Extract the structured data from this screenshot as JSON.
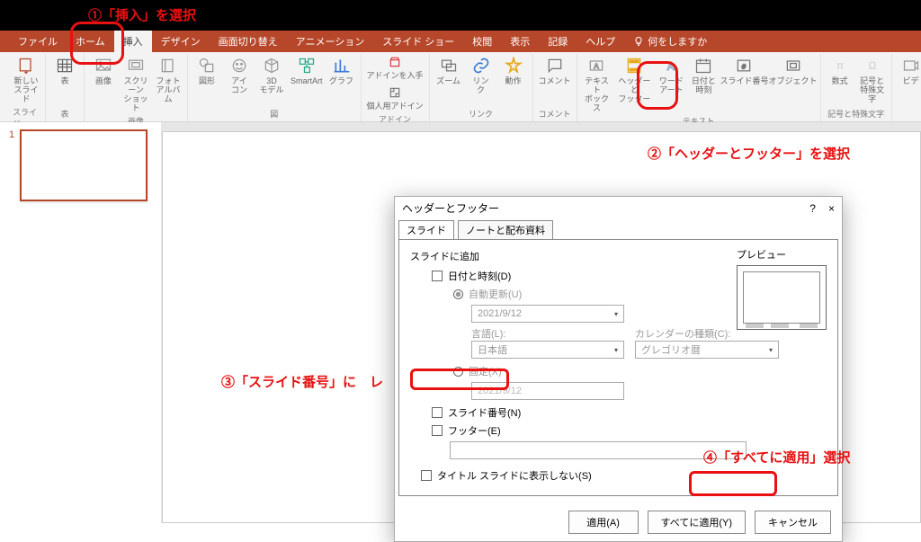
{
  "annotations": {
    "a1": "①「挿入」を選択",
    "a2": "②「ヘッダーとフッター」を選択",
    "a3": "③「スライド番号」に　レ",
    "a4": "④「すべてに適用」選択"
  },
  "tabs": {
    "file": "ファイル",
    "home": "ホーム",
    "insert": "挿入",
    "design": "デザイン",
    "transitions": "画面切り替え",
    "animations": "アニメーション",
    "slideshow": "スライド ショー",
    "review": "校閲",
    "view": "表示",
    "record": "記録",
    "help": "ヘルプ",
    "search_placeholder": "何をしますか"
  },
  "ribbon": {
    "groups": {
      "slides": "スライド",
      "tables": "表",
      "images": "画像",
      "illustrations": "図",
      "addins": "アドイン",
      "links": "リンク",
      "comments": "コメント",
      "text": "テキスト",
      "symbols": "記号と特殊文字"
    },
    "buttons": {
      "new_slide": "新しい\nスライド",
      "table": "表",
      "images": "画像",
      "screenshot": "スクリーン\nショット",
      "photo_album": "フォト\nアルバム",
      "shapes": "図形",
      "icons": "アイ\nコン",
      "models3d": "3D\nモデル",
      "smartart": "SmartArt",
      "chart": "グラフ",
      "getaddins": "アドインを入手",
      "myaddins": "個人用アドイン",
      "zoom": "ズーム",
      "link": "リン\nク",
      "action": "動作",
      "comment": "コメント",
      "textbox": "テキスト\nボックス",
      "header_footer": "ヘッダーと\nフッター",
      "wordart": "ワード\nアート",
      "datetime": "日付と\n時刻",
      "slide_number": "スライド番号",
      "object": "オブジェクト",
      "equation": "数式",
      "symbol": "記号と\n特殊文字",
      "video": "ビデ"
    }
  },
  "slides_panel": {
    "s1_num": "1"
  },
  "dialog": {
    "title": "ヘッダーとフッター",
    "help_btn": "?",
    "close_btn": "×",
    "tab_slide": "スライド",
    "tab_notes": "ノートと配布資料",
    "section_include": "スライドに追加",
    "chk_datetime": "日付と時刻(D)",
    "rad_auto": "自動更新(U)",
    "date_value": "2021/9/12",
    "lang_label": "言語(L):",
    "lang_value": "日本語",
    "cal_label": "カレンダーの種類(C):",
    "cal_value": "グレゴリオ暦",
    "rad_fixed": "固定(X)",
    "fixed_value": "2021/9/12",
    "chk_slide_no": "スライド番号(N)",
    "chk_footer": "フッター(E)",
    "chk_title_hide": "タイトル スライドに表示しない(S)",
    "preview_label": "プレビュー",
    "btn_apply": "適用(A)",
    "btn_apply_all": "すべてに適用(Y)",
    "btn_cancel": "キャンセル"
  }
}
